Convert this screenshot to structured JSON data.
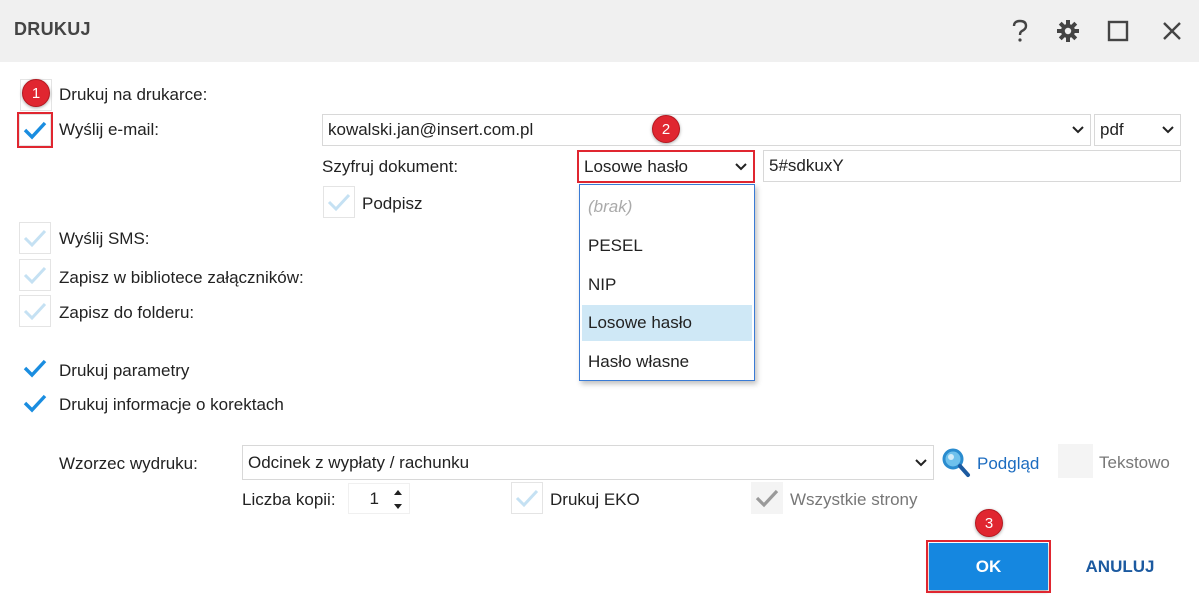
{
  "window": {
    "title": "DRUKUJ"
  },
  "options": {
    "print_label": "Drukuj na drukarce:",
    "email_label": "Wyślij e-mail:",
    "sms_label": "Wyślij SMS:",
    "library_label": "Zapisz w bibliotece załączników:",
    "folder_label": "Zapisz do folderu:",
    "params_label": "Drukuj parametry",
    "corrections_label": "Drukuj informacje o korektach"
  },
  "email": {
    "address": "kowalski.jan@insert.com.pl",
    "format": "pdf",
    "encrypt_label": "Szyfruj dokument:",
    "encrypt_value": "Losowe hasło",
    "password": "5#sdkuxY",
    "sign_label": "Podpisz"
  },
  "encrypt_options": [
    "(brak)",
    "PESEL",
    "NIP",
    "Losowe hasło",
    "Hasło własne"
  ],
  "template": {
    "label": "Wzorzec wydruku:",
    "value": "Odcinek z wypłaty / rachunku",
    "preview_label": "Podgląd",
    "text_label": "Tekstowo",
    "copies_label": "Liczba kopii:",
    "copies_value": "1",
    "eko_label": "Drukuj EKO",
    "all_pages_label": "Wszystkie strony"
  },
  "buttons": {
    "ok": "OK",
    "cancel": "ANULUJ"
  },
  "badges": {
    "one": "1",
    "two": "2",
    "three": "3"
  },
  "colors": {
    "accent": "#1587e0",
    "check": "#1a8de0",
    "badge": "#e02630",
    "highlight": "#cfe8f6"
  }
}
